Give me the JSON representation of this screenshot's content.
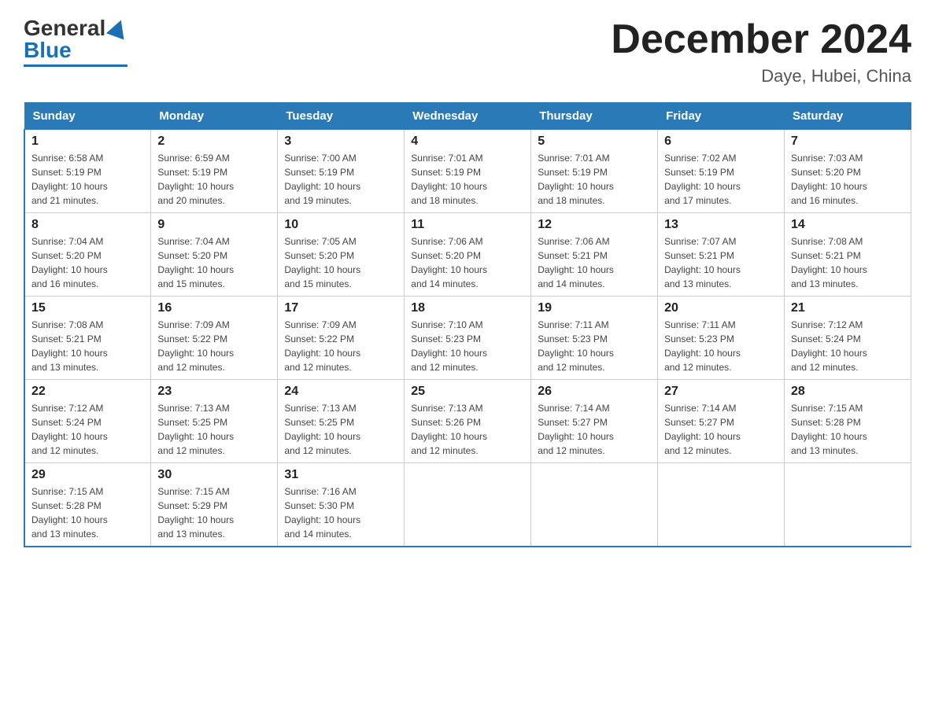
{
  "logo": {
    "general": "General",
    "blue": "Blue"
  },
  "title": "December 2024",
  "subtitle": "Daye, Hubei, China",
  "days_of_week": [
    "Sunday",
    "Monday",
    "Tuesday",
    "Wednesday",
    "Thursday",
    "Friday",
    "Saturday"
  ],
  "weeks": [
    [
      {
        "day": "1",
        "sunrise": "6:58 AM",
        "sunset": "5:19 PM",
        "daylight": "10 hours and 21 minutes."
      },
      {
        "day": "2",
        "sunrise": "6:59 AM",
        "sunset": "5:19 PM",
        "daylight": "10 hours and 20 minutes."
      },
      {
        "day": "3",
        "sunrise": "7:00 AM",
        "sunset": "5:19 PM",
        "daylight": "10 hours and 19 minutes."
      },
      {
        "day": "4",
        "sunrise": "7:01 AM",
        "sunset": "5:19 PM",
        "daylight": "10 hours and 18 minutes."
      },
      {
        "day": "5",
        "sunrise": "7:01 AM",
        "sunset": "5:19 PM",
        "daylight": "10 hours and 18 minutes."
      },
      {
        "day": "6",
        "sunrise": "7:02 AM",
        "sunset": "5:19 PM",
        "daylight": "10 hours and 17 minutes."
      },
      {
        "day": "7",
        "sunrise": "7:03 AM",
        "sunset": "5:20 PM",
        "daylight": "10 hours and 16 minutes."
      }
    ],
    [
      {
        "day": "8",
        "sunrise": "7:04 AM",
        "sunset": "5:20 PM",
        "daylight": "10 hours and 16 minutes."
      },
      {
        "day": "9",
        "sunrise": "7:04 AM",
        "sunset": "5:20 PM",
        "daylight": "10 hours and 15 minutes."
      },
      {
        "day": "10",
        "sunrise": "7:05 AM",
        "sunset": "5:20 PM",
        "daylight": "10 hours and 15 minutes."
      },
      {
        "day": "11",
        "sunrise": "7:06 AM",
        "sunset": "5:20 PM",
        "daylight": "10 hours and 14 minutes."
      },
      {
        "day": "12",
        "sunrise": "7:06 AM",
        "sunset": "5:21 PM",
        "daylight": "10 hours and 14 minutes."
      },
      {
        "day": "13",
        "sunrise": "7:07 AM",
        "sunset": "5:21 PM",
        "daylight": "10 hours and 13 minutes."
      },
      {
        "day": "14",
        "sunrise": "7:08 AM",
        "sunset": "5:21 PM",
        "daylight": "10 hours and 13 minutes."
      }
    ],
    [
      {
        "day": "15",
        "sunrise": "7:08 AM",
        "sunset": "5:21 PM",
        "daylight": "10 hours and 13 minutes."
      },
      {
        "day": "16",
        "sunrise": "7:09 AM",
        "sunset": "5:22 PM",
        "daylight": "10 hours and 12 minutes."
      },
      {
        "day": "17",
        "sunrise": "7:09 AM",
        "sunset": "5:22 PM",
        "daylight": "10 hours and 12 minutes."
      },
      {
        "day": "18",
        "sunrise": "7:10 AM",
        "sunset": "5:23 PM",
        "daylight": "10 hours and 12 minutes."
      },
      {
        "day": "19",
        "sunrise": "7:11 AM",
        "sunset": "5:23 PM",
        "daylight": "10 hours and 12 minutes."
      },
      {
        "day": "20",
        "sunrise": "7:11 AM",
        "sunset": "5:23 PM",
        "daylight": "10 hours and 12 minutes."
      },
      {
        "day": "21",
        "sunrise": "7:12 AM",
        "sunset": "5:24 PM",
        "daylight": "10 hours and 12 minutes."
      }
    ],
    [
      {
        "day": "22",
        "sunrise": "7:12 AM",
        "sunset": "5:24 PM",
        "daylight": "10 hours and 12 minutes."
      },
      {
        "day": "23",
        "sunrise": "7:13 AM",
        "sunset": "5:25 PM",
        "daylight": "10 hours and 12 minutes."
      },
      {
        "day": "24",
        "sunrise": "7:13 AM",
        "sunset": "5:25 PM",
        "daylight": "10 hours and 12 minutes."
      },
      {
        "day": "25",
        "sunrise": "7:13 AM",
        "sunset": "5:26 PM",
        "daylight": "10 hours and 12 minutes."
      },
      {
        "day": "26",
        "sunrise": "7:14 AM",
        "sunset": "5:27 PM",
        "daylight": "10 hours and 12 minutes."
      },
      {
        "day": "27",
        "sunrise": "7:14 AM",
        "sunset": "5:27 PM",
        "daylight": "10 hours and 12 minutes."
      },
      {
        "day": "28",
        "sunrise": "7:15 AM",
        "sunset": "5:28 PM",
        "daylight": "10 hours and 13 minutes."
      }
    ],
    [
      {
        "day": "29",
        "sunrise": "7:15 AM",
        "sunset": "5:28 PM",
        "daylight": "10 hours and 13 minutes."
      },
      {
        "day": "30",
        "sunrise": "7:15 AM",
        "sunset": "5:29 PM",
        "daylight": "10 hours and 13 minutes."
      },
      {
        "day": "31",
        "sunrise": "7:16 AM",
        "sunset": "5:30 PM",
        "daylight": "10 hours and 14 minutes."
      },
      null,
      null,
      null,
      null
    ]
  ],
  "labels": {
    "sunrise": "Sunrise:",
    "sunset": "Sunset:",
    "daylight": "Daylight:"
  }
}
